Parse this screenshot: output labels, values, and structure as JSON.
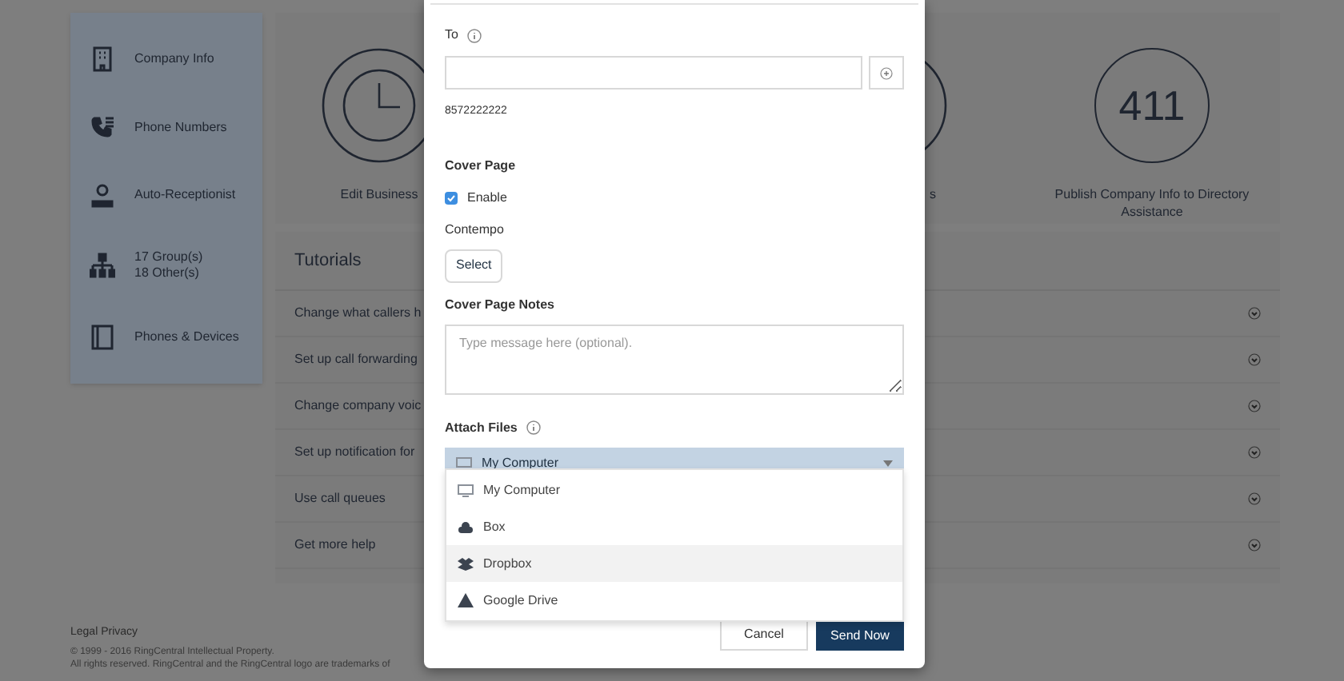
{
  "sidebar": {
    "items": [
      {
        "kind": "building",
        "label": "Company Info"
      },
      {
        "kind": "phone",
        "label": "Phone Numbers"
      },
      {
        "kind": "receptionist",
        "label": "Auto-Receptionist"
      },
      {
        "kind": "org",
        "label": "17 Group(s)",
        "sublabel": "18 Other(s)"
      },
      {
        "kind": "devices",
        "label": "Phones & Devices"
      }
    ]
  },
  "shortcuts": [
    {
      "kind": "clock",
      "label": "Edit Business"
    },
    {
      "kind": "ring",
      "label": "s"
    },
    {
      "kind": "number",
      "number": "411",
      "label": "Publish Company Info to Directory Assistance"
    }
  ],
  "tutorials": {
    "title": "Tutorials",
    "rows": [
      "Change what callers h",
      "Set up call forwarding",
      "Change company voic",
      "Set up notification for",
      "Use call queues",
      "Get more help"
    ]
  },
  "footer": {
    "links": "Legal Privacy",
    "copyright": [
      "© 1999 - 2016 RingCentral Intellectual Property.",
      "All rights reserved. RingCentral and the RingCentral logo are trademarks of"
    ]
  },
  "dialog": {
    "to_label": "To",
    "number": "8572222222",
    "cover_page_label": "Cover Page",
    "enable": {
      "label": "Enable",
      "checked": true
    },
    "template": "Contempo",
    "select_button": "Select",
    "notes_label": "Cover Page Notes",
    "notes": {
      "placeholder": "Type message here (optional)."
    },
    "attach_label": "Attach Files",
    "attach_select": {
      "value": "My Computer",
      "expanded": true,
      "options": [
        {
          "kind": "computer",
          "label": "My Computer",
          "highlighted": false
        },
        {
          "kind": "box",
          "label": "Box",
          "highlighted": false
        },
        {
          "kind": "dropbox",
          "label": "Dropbox",
          "highlighted": true
        },
        {
          "kind": "drive",
          "label": "Google Drive",
          "highlighted": false
        }
      ]
    },
    "buttons": [
      {
        "kind": "secondary",
        "label": "Cancel"
      },
      {
        "kind": "primary",
        "label": "Send Now"
      }
    ]
  }
}
